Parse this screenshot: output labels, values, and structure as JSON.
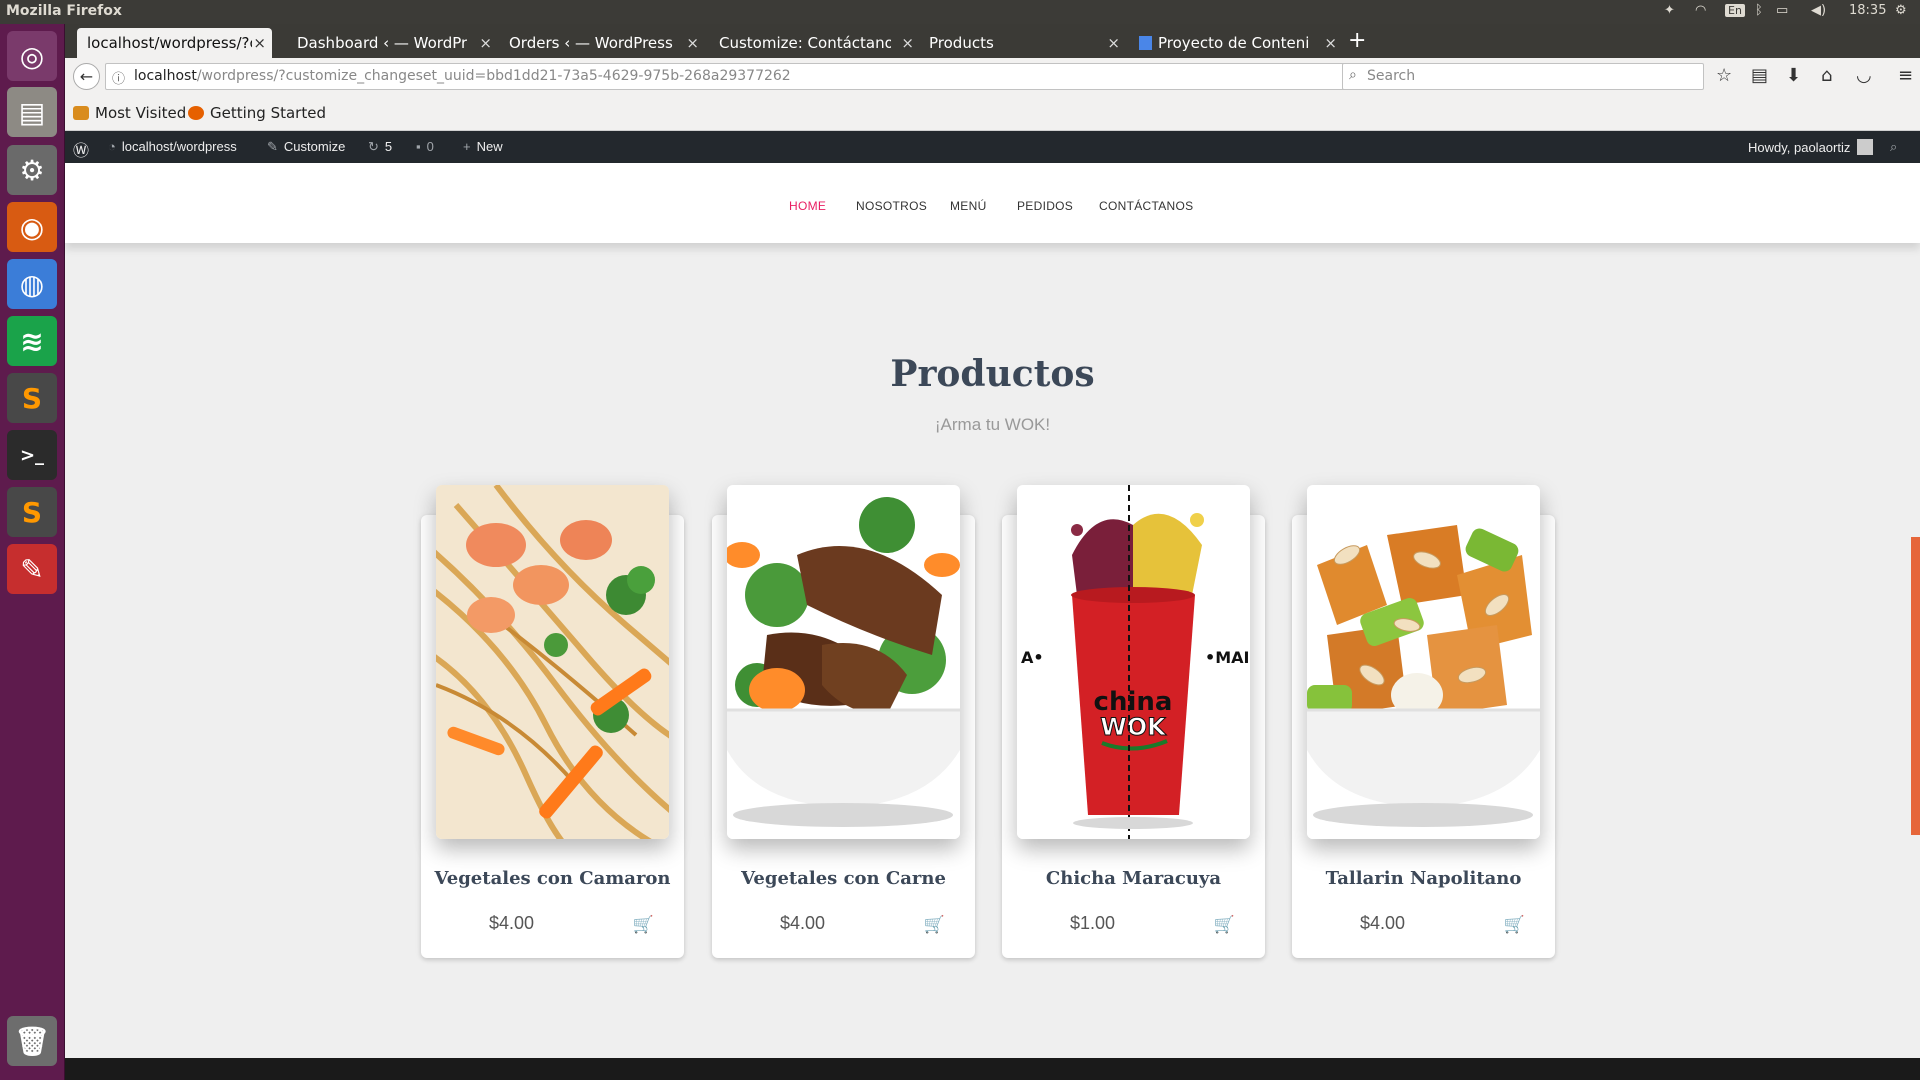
{
  "os": {
    "window_title": "Mozilla Firefox",
    "keyboard_layout": "En",
    "clock": "18:35"
  },
  "launcher": [
    {
      "icon": "ubuntu-dash-icon",
      "color": "#6f2a5e"
    },
    {
      "icon": "files-icon",
      "color": "#8a8a85"
    },
    {
      "icon": "system-settings-icon",
      "color": "#777"
    },
    {
      "icon": "firefox-icon",
      "color": "#e66000"
    },
    {
      "icon": "chrome-icon",
      "color": "#4285f4"
    },
    {
      "icon": "spotify-icon",
      "color": "#1db954"
    },
    {
      "icon": "sublime-text-icon",
      "color": "#4b4b4b"
    },
    {
      "icon": "terminal-icon",
      "color": "#2c2c2c"
    },
    {
      "icon": "sublime-text-icon",
      "color": "#4b4b4b"
    },
    {
      "icon": "pdf-viewer-icon",
      "color": "#c33"
    },
    {
      "icon": "trash-icon",
      "color": "#777"
    }
  ],
  "browser": {
    "tabs": [
      {
        "label": "localhost/wordpress/?cus",
        "active": true
      },
      {
        "label": "Dashboard ‹ — WordPress",
        "active": false
      },
      {
        "label": "Orders ‹ — WordPress",
        "active": false
      },
      {
        "label": "Customize: Contáctanos",
        "active": false
      },
      {
        "label": "Products",
        "active": false
      },
      {
        "label": "Proyecto de Contenido",
        "active": false
      }
    ],
    "url_host": "localhost",
    "url_rest": "/wordpress/?customize_changeset_uuid=bbd1dd21-73a5-4629-975b-268a29377262",
    "search_placeholder": "Search",
    "bookmarks": [
      {
        "label": "Most Visited",
        "icon": "folder-icon"
      },
      {
        "label": "Getting Started",
        "icon": "firefox-icon"
      }
    ]
  },
  "wp_admin_bar": {
    "site": "localhost/wordpress",
    "customize": "Customize",
    "updates_count": "5",
    "comments_count": "0",
    "new": "New",
    "howdy": "Howdy, paolaortiz"
  },
  "site_nav": [
    "HOME",
    "NOSOTROS",
    "MENÚ",
    "PEDIDOS",
    "CONTÁCTANOS"
  ],
  "section": {
    "title": "Productos",
    "subtitle": "¡Arma tu WOK!"
  },
  "products": [
    {
      "name": "Vegetales con Camaron",
      "price": "$4.00",
      "image": "noodles-shrimp"
    },
    {
      "name": "Vegetales con Carne",
      "price": "$4.00",
      "image": "beef-broccoli"
    },
    {
      "name": "Chicha Maracuya",
      "price": "$1.00",
      "image": "china-wok-cup"
    },
    {
      "name": "Tallarin Napolitano",
      "price": "$4.00",
      "image": "chicken-almonds"
    }
  ],
  "product_image_text": {
    "cup_logo_1": "china",
    "cup_logo_2": "WOK",
    "cup_left": "A•",
    "cup_right": "•MAI"
  },
  "colors": {
    "accent": "#e91e63",
    "launcher": "#5e1b4d",
    "wp_bar": "#23282d"
  }
}
